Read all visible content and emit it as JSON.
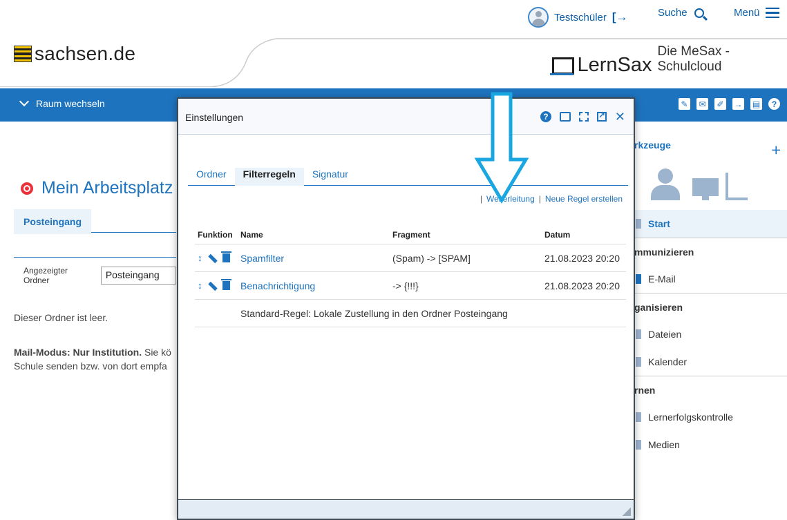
{
  "topbar": {
    "user_name": "Testschüler",
    "search_label": "Suche",
    "menu_label": "Menü"
  },
  "header": {
    "brand": "sachsen.de",
    "product_name": "LernSax",
    "product_tagline": "Die MeSax - Schulcloud"
  },
  "nav": {
    "room_switch": "Raum wechseln"
  },
  "workspace": {
    "title": "Mein Arbeitsplatz",
    "inbox_tab": "Posteingang",
    "folder_label": "Angezeigter Ordner",
    "folder_value": "Posteingang",
    "empty_text": "Dieser Ordner ist leer.",
    "mailmode_bold": "Mail-Modus: Nur Institution.",
    "mailmode_line1_rest": " Sie kö",
    "mailmode_line2": "Schule senden bzw. von dort empfa"
  },
  "sidebar": {
    "title": "rkzeuge",
    "items": [
      {
        "label": "Start",
        "type": "active"
      },
      {
        "label": "mmunizieren",
        "type": "section"
      },
      {
        "label": "E-Mail",
        "type": "mail"
      },
      {
        "label": "ganisieren",
        "type": "section"
      },
      {
        "label": "Dateien",
        "type": "item"
      },
      {
        "label": "Kalender",
        "type": "item"
      },
      {
        "label": "rnen",
        "type": "section"
      },
      {
        "label": "Lernerfolgskontrolle",
        "type": "item"
      },
      {
        "label": "Medien",
        "type": "item"
      }
    ]
  },
  "modal": {
    "title": "Einstellungen",
    "tabs": [
      "Ordner",
      "Filterregeln",
      "Signatur"
    ],
    "active_tab": "Filterregeln",
    "links": {
      "forward": "Weiterleitung",
      "new_rule": "Neue Regel erstellen"
    },
    "table": {
      "headers": [
        "Funktion",
        "Name",
        "Fragment",
        "Datum"
      ],
      "rows": [
        {
          "name": "Spamfilter",
          "fragment": "(Spam) -> [SPAM]",
          "date": "21.08.2023 20:20"
        },
        {
          "name": "Benachrichtigung",
          "fragment": "-> {!!!}",
          "date": "21.08.2023 20:20"
        }
      ],
      "default_rule": "Standard-Regel: Lokale Zustellung in den Ordner Posteingang"
    }
  },
  "colors": {
    "primary_blue": "#1e73be",
    "arrow_cyan": "#1aa6e0"
  }
}
